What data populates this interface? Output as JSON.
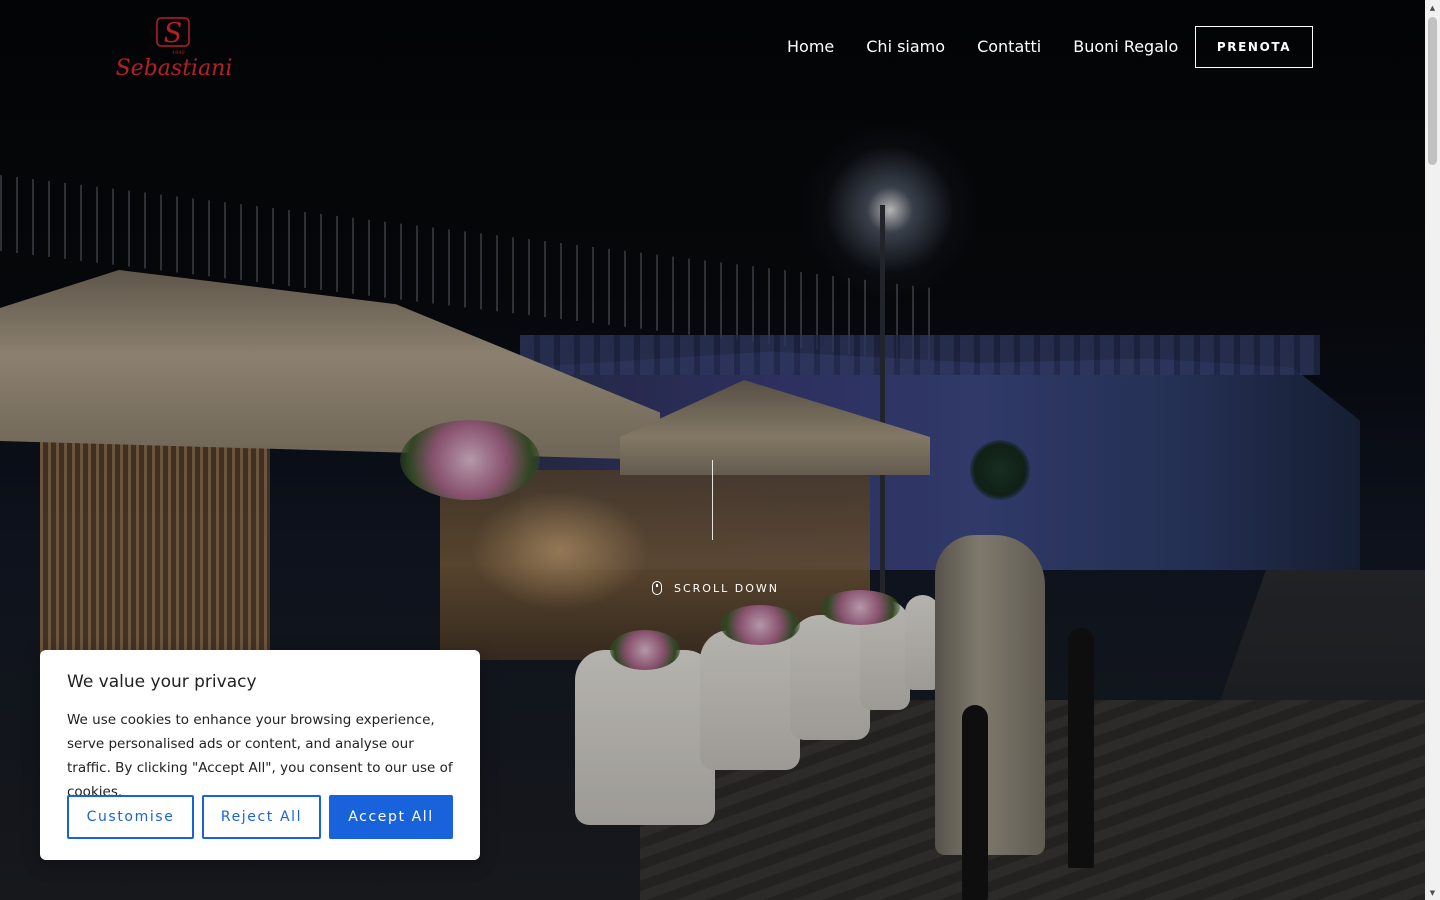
{
  "header": {
    "logo": {
      "letter": "S",
      "wordmark": "Sebastiani",
      "year": "1940"
    },
    "nav": [
      "Home",
      "Chi siamo",
      "Contatti",
      "Buoni Regalo"
    ],
    "cta_label": "PRENOTA"
  },
  "hero": {
    "scroll_label": "SCROLL DOWN"
  },
  "cookie_banner": {
    "title": "We value your privacy",
    "text": "We use cookies to enhance your browsing experience, serve personalised ads or content, and analyse our traffic. By clicking \"Accept All\", you consent to our use of cookies.",
    "buttons": {
      "customise": "Customise",
      "reject": "Reject All",
      "accept": "Accept All"
    }
  },
  "colors": {
    "brand_red": "#b51f2a",
    "cookie_accent": "#1863dc",
    "header_text": "#ffffff"
  },
  "icons": {
    "scroll": "mouse-icon",
    "scrollbar_up": "chevron-up-icon",
    "scrollbar_down": "chevron-down-icon"
  }
}
